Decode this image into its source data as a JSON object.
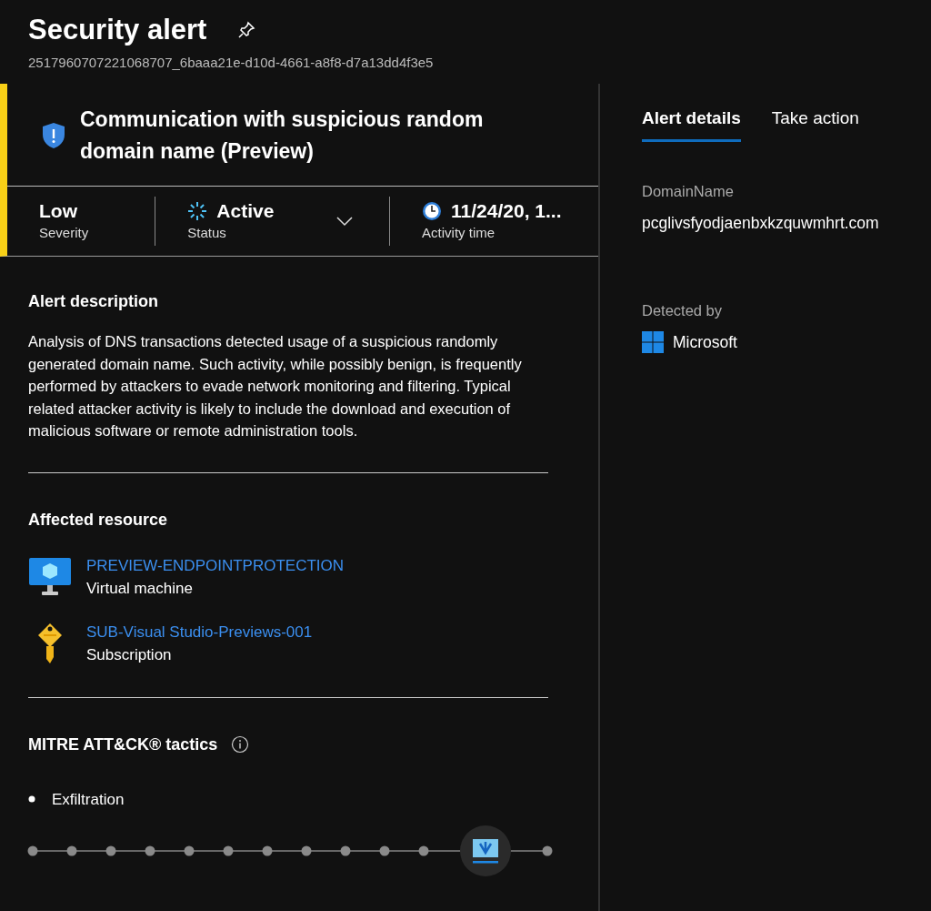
{
  "header": {
    "title": "Security alert",
    "alert_id": "2517960707221068707_6baaa21e-d10d-4661-a8f8-d7a13dd4f3e5"
  },
  "alert": {
    "title": "Communication with suspicious random domain name (Preview)",
    "stats": [
      {
        "kind": "severity",
        "value": "Low",
        "label": "Severity",
        "color": "#f8d017"
      },
      {
        "kind": "status",
        "value": "Active",
        "label": "Status",
        "expanded": false
      },
      {
        "kind": "time",
        "value": "11/24/20, 1...",
        "label": "Activity time"
      }
    ]
  },
  "description": {
    "heading": "Alert description",
    "text": "Analysis of DNS transactions detected usage of a suspicious randomly generated domain name. Such activity, while possibly benign, is frequently performed by attackers to evade network monitoring and filtering. Typical related attacker activity is likely to include the download and execution of malicious software or remote administration tools."
  },
  "affected_resource": {
    "heading": "Affected resource",
    "items": [
      {
        "kind": "vm",
        "name": "PREVIEW-ENDPOINTPROTECTION",
        "type": "Virtual machine"
      },
      {
        "kind": "subscription",
        "name": "SUB-Visual Studio-Previews-001",
        "type": "Subscription"
      }
    ]
  },
  "mitre": {
    "heading": "MITRE ATT&CK® tactics",
    "tactics": [
      "Exfiltration"
    ],
    "stages": [
      {
        "selected": false
      },
      {
        "selected": false
      },
      {
        "selected": false
      },
      {
        "selected": false
      },
      {
        "selected": false
      },
      {
        "selected": false
      },
      {
        "selected": false
      },
      {
        "selected": false
      },
      {
        "selected": false
      },
      {
        "selected": false
      },
      {
        "selected": false
      },
      {
        "selected": true
      },
      {
        "selected": false
      }
    ]
  },
  "tabs": [
    {
      "label": "Alert details",
      "selected": true
    },
    {
      "label": "Take action",
      "selected": false
    }
  ],
  "details": [
    {
      "kind": "text",
      "label": "DomainName",
      "value": "pcglivsfyodjaenbxkzquwmhrt.com"
    },
    {
      "kind": "vendor",
      "label": "Detected by",
      "value": "Microsoft"
    }
  ]
}
